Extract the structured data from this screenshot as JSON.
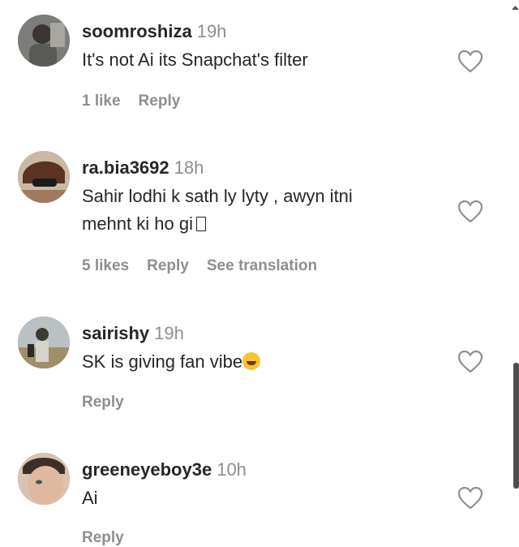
{
  "comments": [
    {
      "username": "soomroshiza",
      "time": "19h",
      "text": "It's not Ai its Snapchat's filter",
      "likes": "1 like",
      "reply": "Reply",
      "avatar_icon": "avatar-photo"
    },
    {
      "username": "ra.bia3692",
      "time": "18h",
      "text_line1": "Sahir lodhi k sath ly lyty , awyn itni",
      "text_line2": "mehnt ki ho gi",
      "likes": "5 likes",
      "reply": "Reply",
      "see_translation": "See translation",
      "avatar_icon": "avatar-photo"
    },
    {
      "username": "sairishy",
      "time": "19h",
      "text": "SK is giving fan vibe",
      "reply": "Reply",
      "avatar_icon": "avatar-photo",
      "emoji": "laughing-tears-emoji"
    },
    {
      "username": "greeneyeboy3e",
      "time": "10h",
      "text": "Ai",
      "reply": "Reply",
      "avatar_icon": "avatar-photo"
    }
  ],
  "icons": {
    "like": "heart-outline-icon"
  },
  "colors": {
    "text": "#262626",
    "muted": "#8e8e8e"
  }
}
